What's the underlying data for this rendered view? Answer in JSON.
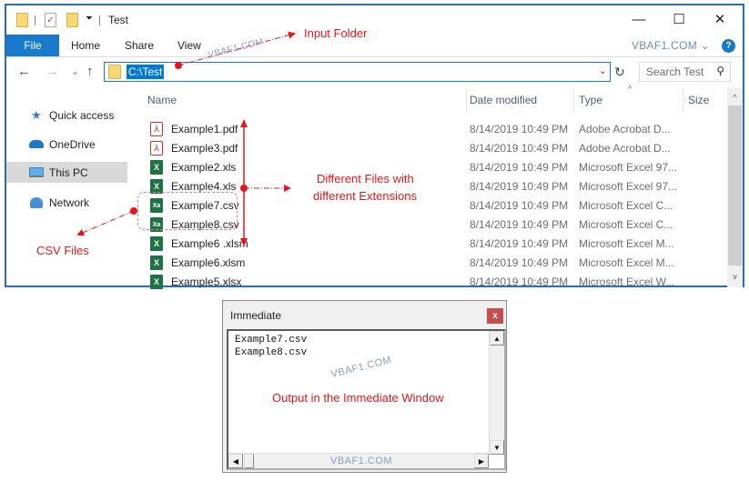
{
  "explorer": {
    "title": "Test",
    "window_controls": {
      "minimize": "—",
      "maximize": "☐",
      "close": "✕"
    },
    "ribbon_tabs": [
      "File",
      "Home",
      "Share",
      "View"
    ],
    "brand": "VBAF1.COM ⌄",
    "help": "?",
    "nav": {
      "back": "←",
      "forward": "→",
      "recent": "⌄",
      "up": "↑",
      "refresh": "↻"
    },
    "address": "C:\\Test",
    "search_placeholder": "Search Test",
    "sidebar": [
      {
        "label": "Quick access",
        "icon": "star-icon"
      },
      {
        "label": "OneDrive",
        "icon": "cloud-icon"
      },
      {
        "label": "This PC",
        "icon": "computer-icon",
        "selected": true
      },
      {
        "label": "Network",
        "icon": "network-icon"
      }
    ],
    "columns": [
      "Name",
      "Date modified",
      "Type",
      "Size"
    ],
    "files": [
      {
        "name": "Example1.pdf",
        "date": "8/14/2019 10:49 PM",
        "type": "Adobe Acrobat D...",
        "icon": "pdf"
      },
      {
        "name": "Example3.pdf",
        "date": "8/14/2019 10:49 PM",
        "type": "Adobe Acrobat D...",
        "icon": "pdf"
      },
      {
        "name": "Example2.xls",
        "date": "8/14/2019 10:49 PM",
        "type": "Microsoft Excel 97...",
        "icon": "xls"
      },
      {
        "name": "Example4.xls",
        "date": "8/14/2019 10:49 PM",
        "type": "Microsoft Excel 97...",
        "icon": "xls"
      },
      {
        "name": "Example7.csv",
        "date": "8/14/2019 10:49 PM",
        "type": "Microsoft Excel C...",
        "icon": "csv"
      },
      {
        "name": "Example8.csv",
        "date": "8/14/2019 10:49 PM",
        "type": "Microsoft Excel C...",
        "icon": "csv"
      },
      {
        "name": "Example6 .xlsm",
        "date": "8/14/2019 10:49 PM",
        "type": "Microsoft Excel M...",
        "icon": "xlsm"
      },
      {
        "name": "Example6.xlsm",
        "date": "8/14/2019 10:49 PM",
        "type": "Microsoft Excel M...",
        "icon": "xlsm"
      },
      {
        "name": "Example5.xlsx",
        "date": "8/14/2019 10:49 PM",
        "type": "Microsoft Excel W...",
        "icon": "xlsx"
      }
    ]
  },
  "annotations": {
    "input_folder": "Input Folder",
    "different_files_1": "Different Files with",
    "different_files_2": "different  Extensions",
    "csv_files": "CSV Files",
    "output": "Output in the Immediate Window",
    "watermark": "VBAF1.COM"
  },
  "immediate": {
    "title": "Immediate",
    "close": "x",
    "lines": [
      "Example7.csv",
      "Example8.csv"
    ],
    "footer_watermark": "VBAF1.COM"
  },
  "colors": {
    "accent": "#1979ca",
    "annotation": "#e8151b",
    "window_border": "#2b6cb7"
  }
}
